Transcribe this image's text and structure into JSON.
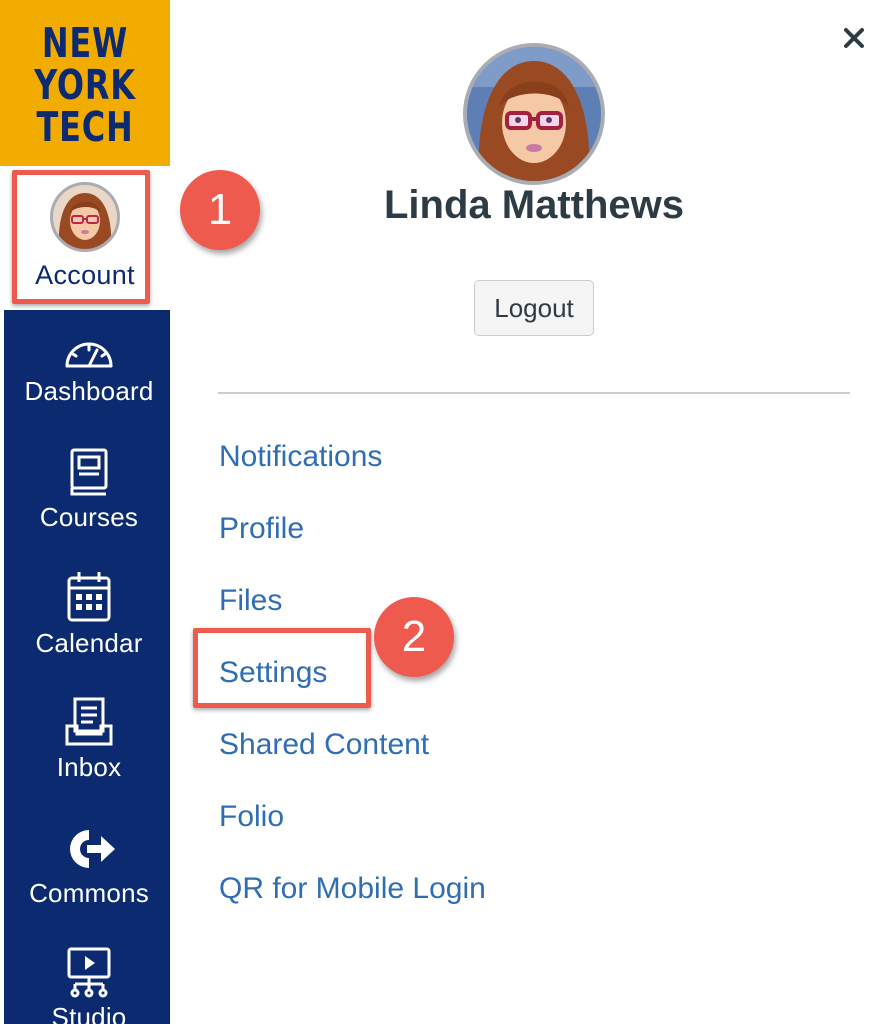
{
  "logo": {
    "lines": [
      "NEW",
      "YORK",
      "TECH"
    ],
    "colors": {
      "background": "#f2ac00",
      "text": "#0b2a6f"
    }
  },
  "global_nav": {
    "background": "#0b2a6f",
    "account": {
      "label": "Account",
      "icon": "user-avatar"
    },
    "items": [
      {
        "label": "Dashboard",
        "icon": "speedometer-icon"
      },
      {
        "label": "Courses",
        "icon": "book-icon"
      },
      {
        "label": "Calendar",
        "icon": "calendar-icon"
      },
      {
        "label": "Inbox",
        "icon": "inbox-icon"
      },
      {
        "label": "Commons",
        "icon": "commons-icon"
      },
      {
        "label": "Studio",
        "icon": "studio-icon"
      }
    ]
  },
  "account_tray": {
    "user_name": "Linda Matthews",
    "logout_label": "Logout",
    "links": [
      "Notifications",
      "Profile",
      "Files",
      "Settings",
      "Shared Content",
      "Folio",
      "QR for Mobile Login"
    ],
    "link_color": "#2f6db5",
    "close_icon": "close-icon"
  },
  "annotations": {
    "step1": "1",
    "step2": "2",
    "highlight_color": "#ef5a4f"
  }
}
